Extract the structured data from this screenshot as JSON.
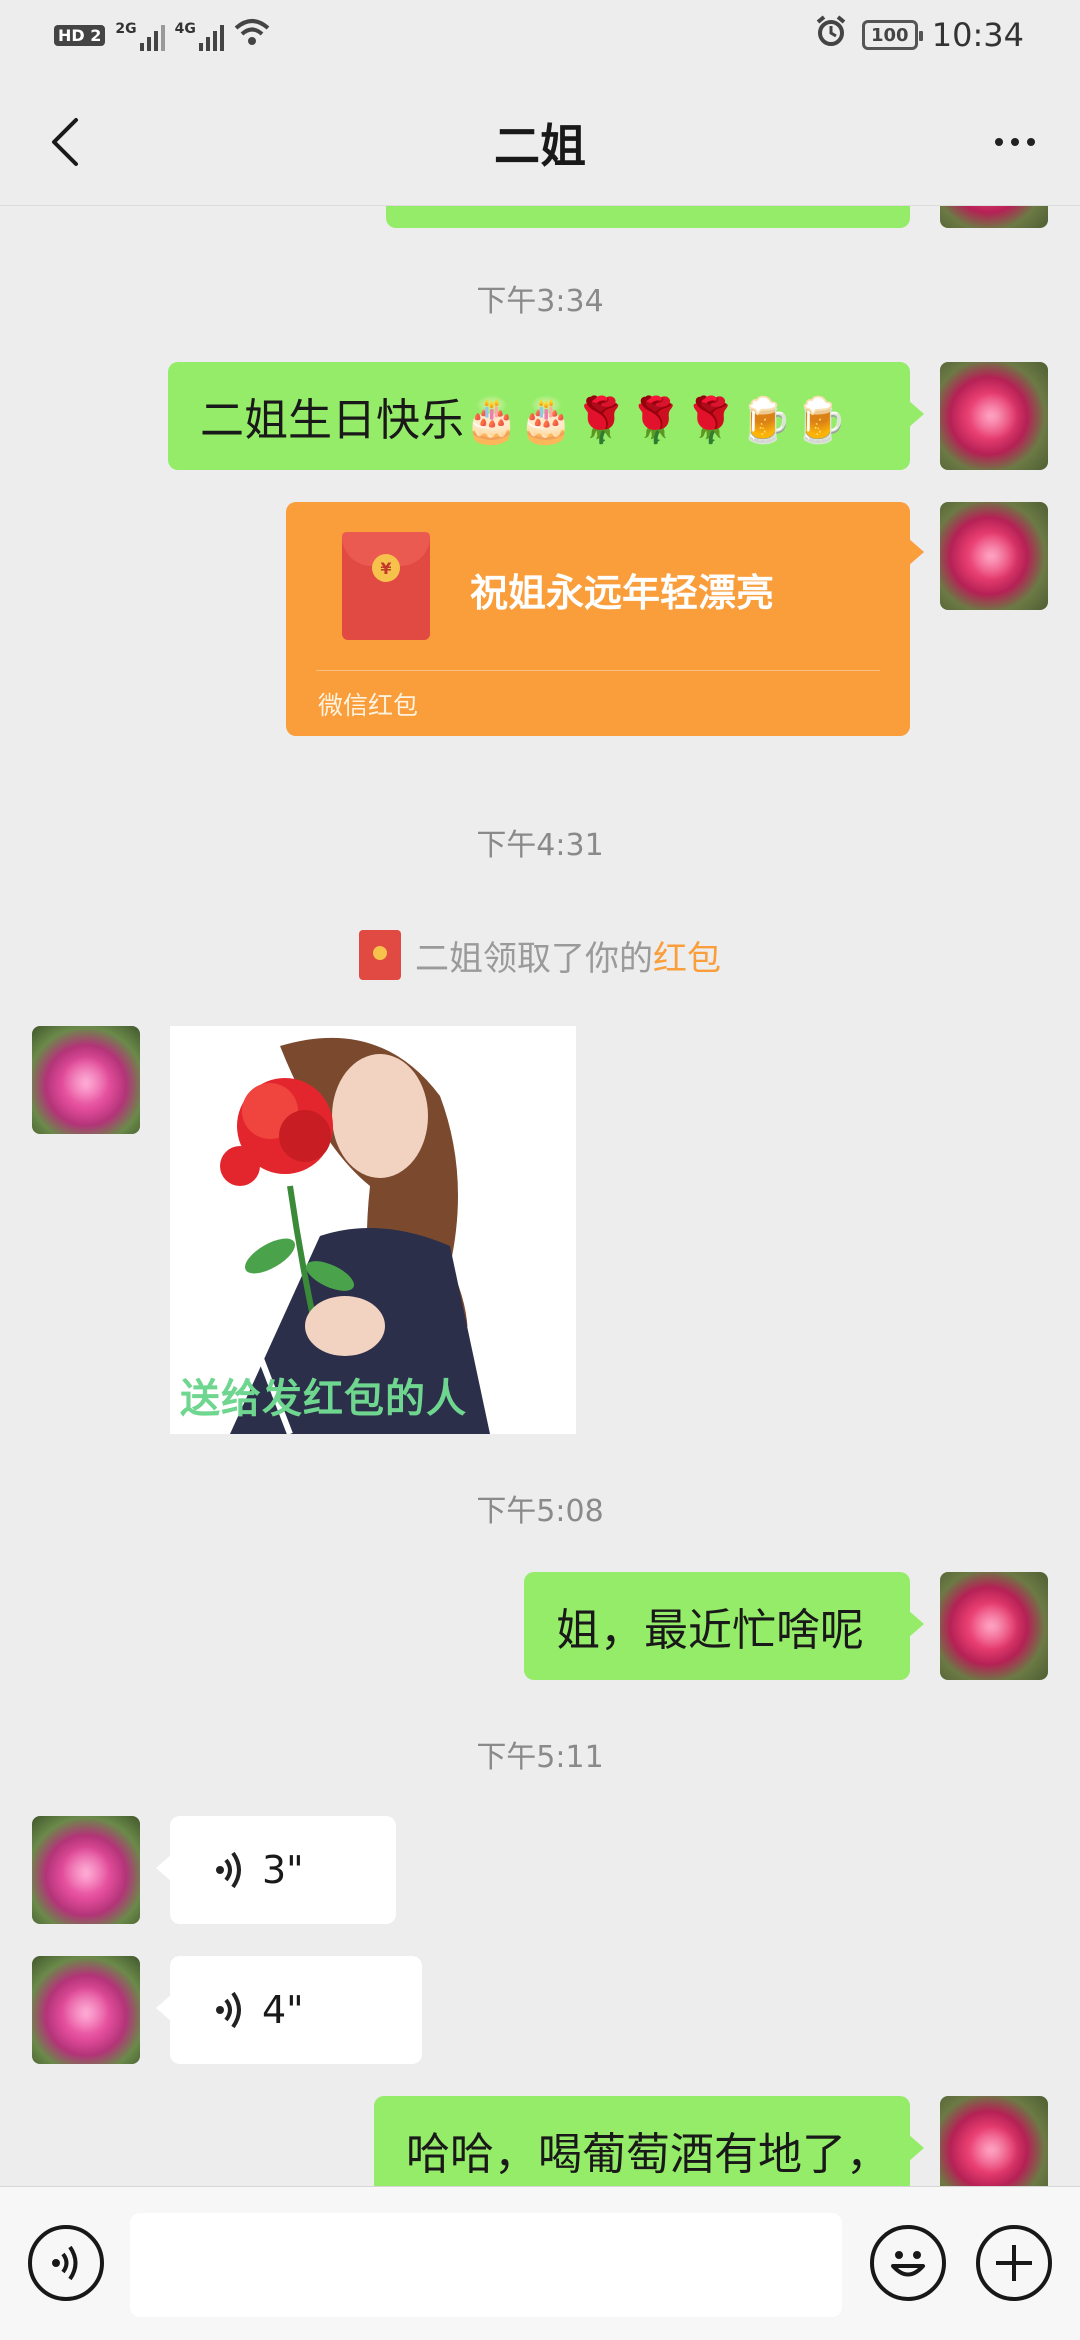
{
  "status_bar": {
    "left_indicators": [
      "HD 2",
      "2G",
      "4G"
    ],
    "battery": "100",
    "time": "10:34"
  },
  "header": {
    "title": "二姐"
  },
  "messages": {
    "time_1": "下午3:34",
    "birthday_text": "二姐生日快乐🎂🎂🌹🌹🌹🍺🍺",
    "red_packet": {
      "title": "祝姐永远年轻漂亮",
      "footer": "微信红包"
    },
    "time_2": "下午4:31",
    "system_note": {
      "text": "二姐领取了你的",
      "link": "红包"
    },
    "image_caption": "送给发红包的人",
    "time_3": "下午5:08",
    "question_text": "姐，最近忙啥呢",
    "time_4": "下午5:11",
    "voice_1_duration": "3\"",
    "voice_2_duration": "4\"",
    "last_text": "哈哈，喝葡萄酒有地了，"
  },
  "input_bar": {
    "voice_icon": "voice-toggle-icon",
    "emoji_icon": "emoji-icon",
    "plus_icon": "plus-icon"
  },
  "colors": {
    "background": "#ededed",
    "my_bubble": "#95ec69",
    "red_packet": "#fa9d3b",
    "red_packet_link": "#fa9d3b"
  }
}
